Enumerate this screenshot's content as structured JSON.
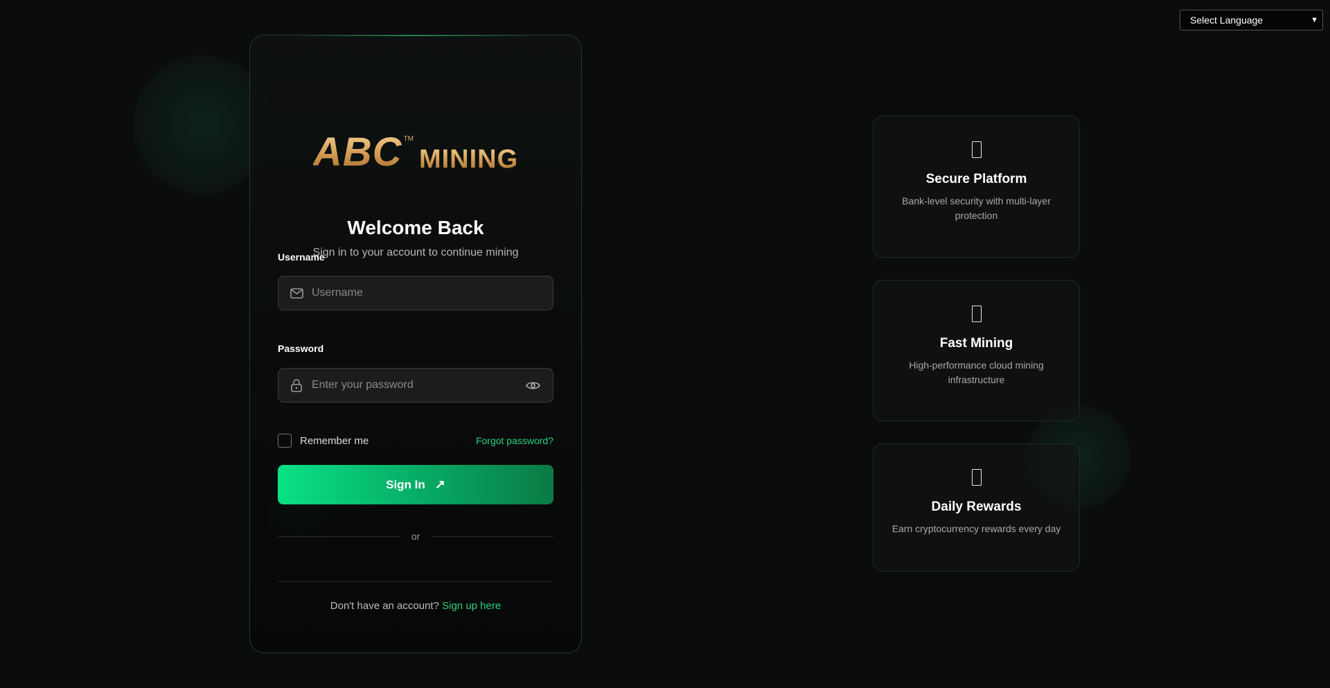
{
  "language_select": {
    "label": "Select Language"
  },
  "brand": {
    "logo_main": "ABC",
    "logo_tm": "TM",
    "logo_sub": "MINING"
  },
  "login": {
    "title": "Welcome Back",
    "subtitle": "Sign in to your account to continue mining",
    "username_label": "Username",
    "username_placeholder": "Username",
    "password_label": "Password",
    "password_placeholder": "Enter your password",
    "remember_label": "Remember me",
    "forgot_link": "Forgot password?",
    "signin_label": "Sign In",
    "signin_icon": "arrow-up-right-icon",
    "divider_text": "or",
    "no_account_text": "Don't have an account?",
    "signup_link": "Sign up here"
  },
  "features": [
    {
      "icon": "shield-icon",
      "title": "Secure Platform",
      "description": "Bank-level security with multi-layer protection"
    },
    {
      "icon": "bolt-icon",
      "title": "Fast Mining",
      "description": "High-performance cloud mining infrastructure"
    },
    {
      "icon": "gift-icon",
      "title": "Daily Rewards",
      "description": "Earn cryptocurrency rewards every day"
    }
  ],
  "colors": {
    "accent": "#2fd07e",
    "button_start": "#0ae184",
    "button_end": "#0b7a45",
    "logo_gold": "#d19a52",
    "background": "#0b0c0c"
  }
}
